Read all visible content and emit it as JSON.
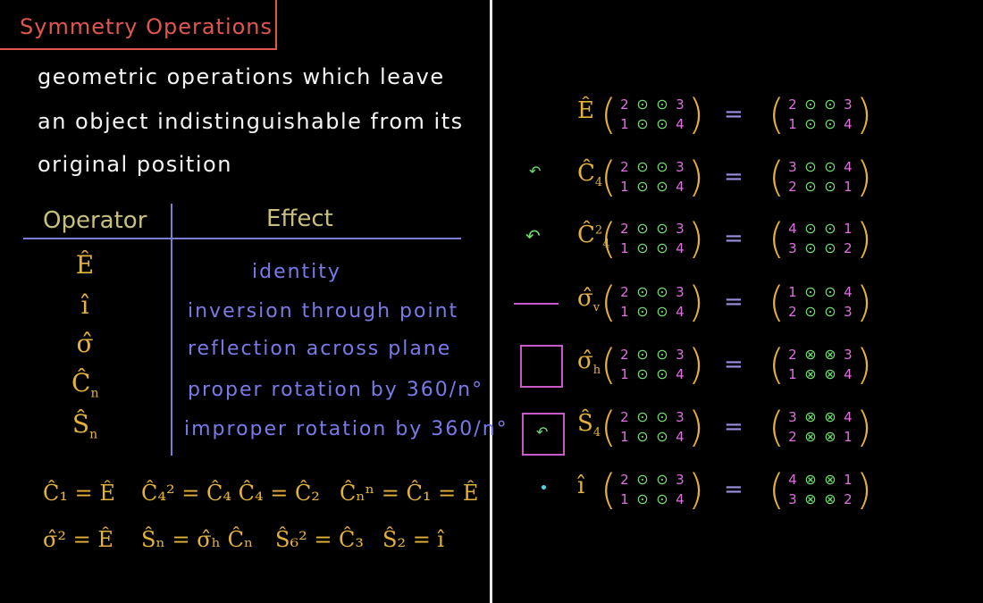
{
  "title": "Symmetry Operations",
  "definition": [
    "geometric operations which leave",
    "an object indistinguishable from its",
    "original position"
  ],
  "table": {
    "header_operator": "Operator",
    "header_effect": "Effect",
    "rows": [
      {
        "op": "Ê",
        "sub": "",
        "effect": "identity"
      },
      {
        "op": "î",
        "sub": "",
        "effect": "inversion through point"
      },
      {
        "op": "σ̂",
        "sub": "",
        "effect": "reflection across plane"
      },
      {
        "op": "Ĉ",
        "sub": "n",
        "effect": "proper rotation by 360/n°"
      },
      {
        "op": "Ŝ",
        "sub": "n",
        "effect": "improper rotation by 360/n°"
      }
    ]
  },
  "relations": {
    "r1": [
      "Ĉ₁ = Ê",
      "Ĉ₄² = Ĉ₄ Ĉ₄ = Ĉ₂",
      "Ĉₙⁿ = Ĉ₁ = Ê"
    ],
    "r2": [
      "σ̂² = Ê",
      "Ŝₙ = σ̂ₕ Ĉₙ",
      "Ŝ₆² = Ĉ₃",
      "Ŝ₂ = î"
    ]
  },
  "operations": [
    {
      "op": "Ê",
      "sub": "",
      "sup": "",
      "lhs": [
        "2",
        "⊙",
        "⊙",
        "3",
        "1",
        "⊙",
        "⊙",
        "4"
      ],
      "rhs": [
        "2",
        "⊙",
        "⊙",
        "3",
        "1",
        "⊙",
        "⊙",
        "4"
      ]
    },
    {
      "op": "Ĉ",
      "sub": "4",
      "sup": "",
      "lhs": [
        "2",
        "⊙",
        "⊙",
        "3",
        "1",
        "⊙",
        "⊙",
        "4"
      ],
      "rhs": [
        "3",
        "⊙",
        "⊙",
        "4",
        "2",
        "⊙",
        "⊙",
        "1"
      ]
    },
    {
      "op": "Ĉ",
      "sub": "4",
      "sup": "2",
      "lhs": [
        "2",
        "⊙",
        "⊙",
        "3",
        "1",
        "⊙",
        "⊙",
        "4"
      ],
      "rhs": [
        "4",
        "⊙",
        "⊙",
        "1",
        "3",
        "⊙",
        "⊙",
        "2"
      ]
    },
    {
      "op": "σ̂",
      "sub": "v",
      "sup": "",
      "lhs": [
        "2",
        "⊙",
        "⊙",
        "3",
        "1",
        "⊙",
        "⊙",
        "4"
      ],
      "rhs": [
        "1",
        "⊙",
        "⊙",
        "4",
        "2",
        "⊙",
        "⊙",
        "3"
      ]
    },
    {
      "op": "σ̂",
      "sub": "h",
      "sup": "",
      "lhs": [
        "2",
        "⊙",
        "⊙",
        "3",
        "1",
        "⊙",
        "⊙",
        "4"
      ],
      "rhs": [
        "2",
        "⊗",
        "⊗",
        "3",
        "1",
        "⊗",
        "⊗",
        "4"
      ]
    },
    {
      "op": "Ŝ",
      "sub": "4",
      "sup": "",
      "lhs": [
        "2",
        "⊙",
        "⊙",
        "3",
        "1",
        "⊙",
        "⊙",
        "4"
      ],
      "rhs": [
        "3",
        "⊗",
        "⊗",
        "4",
        "2",
        "⊗",
        "⊗",
        "1"
      ]
    },
    {
      "op": "î",
      "sub": "",
      "sup": "",
      "lhs": [
        "2",
        "⊙",
        "⊙",
        "3",
        "1",
        "⊙",
        "⊙",
        "4"
      ],
      "rhs": [
        "4",
        "⊗",
        "⊗",
        "1",
        "3",
        "⊗",
        "⊗",
        "2"
      ]
    }
  ],
  "equals": "=",
  "colors": {
    "title": "#e0574f",
    "operator": "#e4b23a",
    "effect": "#7a7ae8",
    "number": "#e06fe0",
    "dot": "#6ee06e",
    "symbol": "#c85ac8",
    "inversion_point": "#4fd8ea"
  }
}
